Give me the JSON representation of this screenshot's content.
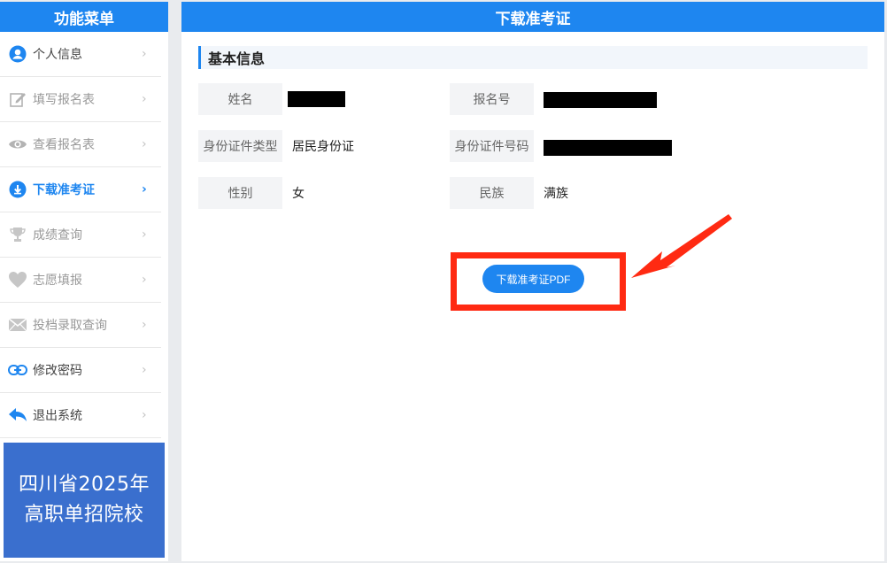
{
  "sidebar": {
    "title": "功能菜单",
    "items": [
      {
        "label": "个人信息",
        "icon": "user-circle-icon"
      },
      {
        "label": "填写报名表",
        "icon": "edit-icon"
      },
      {
        "label": "查看报名表",
        "icon": "eye-icon"
      },
      {
        "label": "下载准考证",
        "icon": "cloud-download-icon"
      },
      {
        "label": "成绩查询",
        "icon": "trophy-icon"
      },
      {
        "label": "志愿填报",
        "icon": "heart-icon"
      },
      {
        "label": "投档录取查询",
        "icon": "envelope-icon"
      },
      {
        "label": "修改密码",
        "icon": "link-icon"
      },
      {
        "label": "退出系统",
        "icon": "reply-arrow-icon"
      }
    ],
    "active_index": 3,
    "promo_line1": "四川省2025年",
    "promo_line2": "高职单招院校"
  },
  "main": {
    "title": "下载准考证",
    "section_title": "基本信息",
    "fields": {
      "name_label": "姓名",
      "reg_no_label": "报名号",
      "id_type_label": "身份证件类型",
      "id_type_value": "居民身份证",
      "id_no_label": "身份证件号码",
      "gender_label": "性别",
      "gender_value": "女",
      "ethnicity_label": "民族",
      "ethnicity_value": "满族"
    },
    "download_button_label": "下载准考证PDF"
  },
  "colors": {
    "brand_blue": "#1e86f0",
    "promo_blue": "#3a6fce",
    "highlight_red": "#ff2a12"
  }
}
